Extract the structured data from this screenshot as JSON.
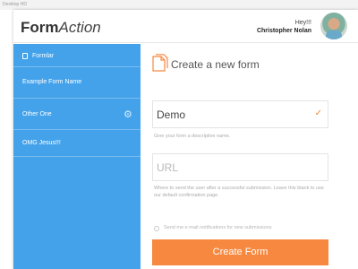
{
  "canvas": {
    "label": "Desktop HD"
  },
  "header": {
    "logo_bold": "Form",
    "logo_italic": "Action",
    "greeting": "Hey!!!",
    "user_name": "Christopher Nolan"
  },
  "sidebar": {
    "items": [
      {
        "label": "Formlar",
        "icon": "document-icon"
      },
      {
        "label": "Example Form Name"
      },
      {
        "label": "Other One",
        "icon": "gear-icon"
      },
      {
        "label": "OMG Jesus!!!"
      }
    ]
  },
  "main": {
    "title": "Create a new form",
    "name_field": {
      "value": "Demo",
      "hint": "Give your form a descriptive name."
    },
    "url_field": {
      "placeholder": "URL",
      "hint": "Where to send the user after a successful submission. Leave this blank to use our default confirmation page."
    },
    "notify_label": "Send me e-mail notifications for new submissions",
    "submit_label": "Create Form"
  },
  "colors": {
    "sidebar": "#44a2ea",
    "accent": "#f7883f"
  }
}
